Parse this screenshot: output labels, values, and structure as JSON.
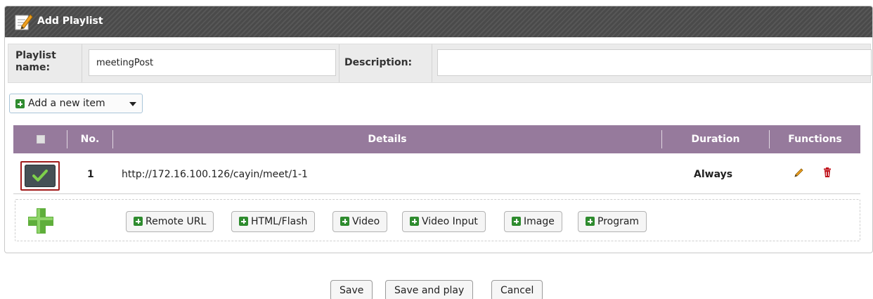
{
  "panel": {
    "title": "Add Playlist",
    "title_icon": "edit-note-icon"
  },
  "form": {
    "name_label": "Playlist name:",
    "name_value": "meetingPost",
    "description_label": "Description:",
    "description_value": ""
  },
  "add_menu": {
    "label": "Add a new item",
    "icon": "plus-square-icon"
  },
  "table": {
    "headers": {
      "select": "",
      "no": "No.",
      "details": "Details",
      "duration": "Duration",
      "functions": "Functions"
    },
    "rows": [
      {
        "selected": true,
        "no": "1",
        "details": "http://172.16.100.126/cayin/meet/1-1",
        "duration": "Always",
        "functions": [
          "edit-pencil-icon",
          "delete-trash-icon"
        ]
      }
    ]
  },
  "item_types": [
    "Remote URL",
    "HTML/Flash",
    "Video",
    "Video Input",
    "Image",
    "Program"
  ],
  "footer": {
    "save": "Save",
    "save_and_play": "Save and play",
    "cancel": "Cancel"
  },
  "colors": {
    "title_bg": "#4a4a4a",
    "table_header": "#967a9c",
    "selection_border": "#a11b1b",
    "plus_green": "#2e8b2e"
  }
}
